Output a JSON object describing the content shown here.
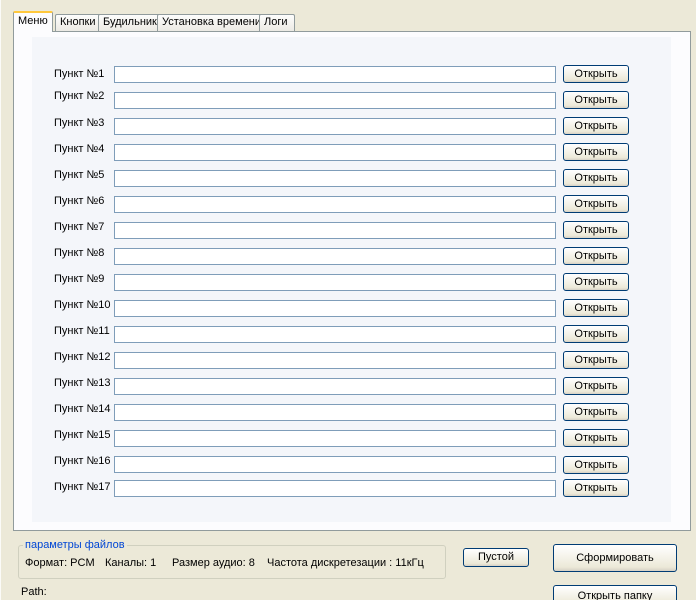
{
  "tabs": [
    "Меню",
    "Кнопки",
    "Будильник",
    "Установка времени",
    "Логи"
  ],
  "menu_items": [
    {
      "label": "Пункт №1",
      "value": "",
      "button": "Открыть"
    },
    {
      "label": "Пункт №2",
      "value": "",
      "button": "Открыть"
    },
    {
      "label": "Пункт №3",
      "value": "",
      "button": "Открыть"
    },
    {
      "label": "Пункт №4",
      "value": "",
      "button": "Открыть"
    },
    {
      "label": "Пункт №5",
      "value": "",
      "button": "Открыть"
    },
    {
      "label": "Пункт №6",
      "value": "",
      "button": "Открыть"
    },
    {
      "label": "Пункт №7",
      "value": "",
      "button": "Открыть"
    },
    {
      "label": "Пункт №8",
      "value": "",
      "button": "Открыть"
    },
    {
      "label": "Пункт №9",
      "value": "",
      "button": "Открыть"
    },
    {
      "label": "Пункт №10",
      "value": "",
      "button": "Открыть"
    },
    {
      "label": "Пункт №11",
      "value": "",
      "button": "Открыть"
    },
    {
      "label": "Пункт №12",
      "value": "",
      "button": "Открыть"
    },
    {
      "label": "Пункт №13",
      "value": "",
      "button": "Открыть"
    },
    {
      "label": "Пункт №14",
      "value": "",
      "button": "Открыть"
    },
    {
      "label": "Пункт №15",
      "value": "",
      "button": "Открыть"
    },
    {
      "label": "Пункт №16",
      "value": "",
      "button": "Открыть"
    },
    {
      "label": "Пункт №17",
      "value": "",
      "button": "Открыть"
    }
  ],
  "file_params": {
    "legend": "параметры файлов",
    "format": "Формат: PCM",
    "channels": "Каналы: 1",
    "audio_size": "Размер аудио: 8",
    "sample_rate": "Частота дискретезации : 11кГц"
  },
  "buttons": {
    "empty": "Пустой",
    "generate": "Сформировать",
    "open_folder": "Открыть папку"
  },
  "path_label": "Path:",
  "colors": {
    "accent_tab": "#ffc83c",
    "legend_text": "#0046d5",
    "button_border": "#003c74"
  }
}
